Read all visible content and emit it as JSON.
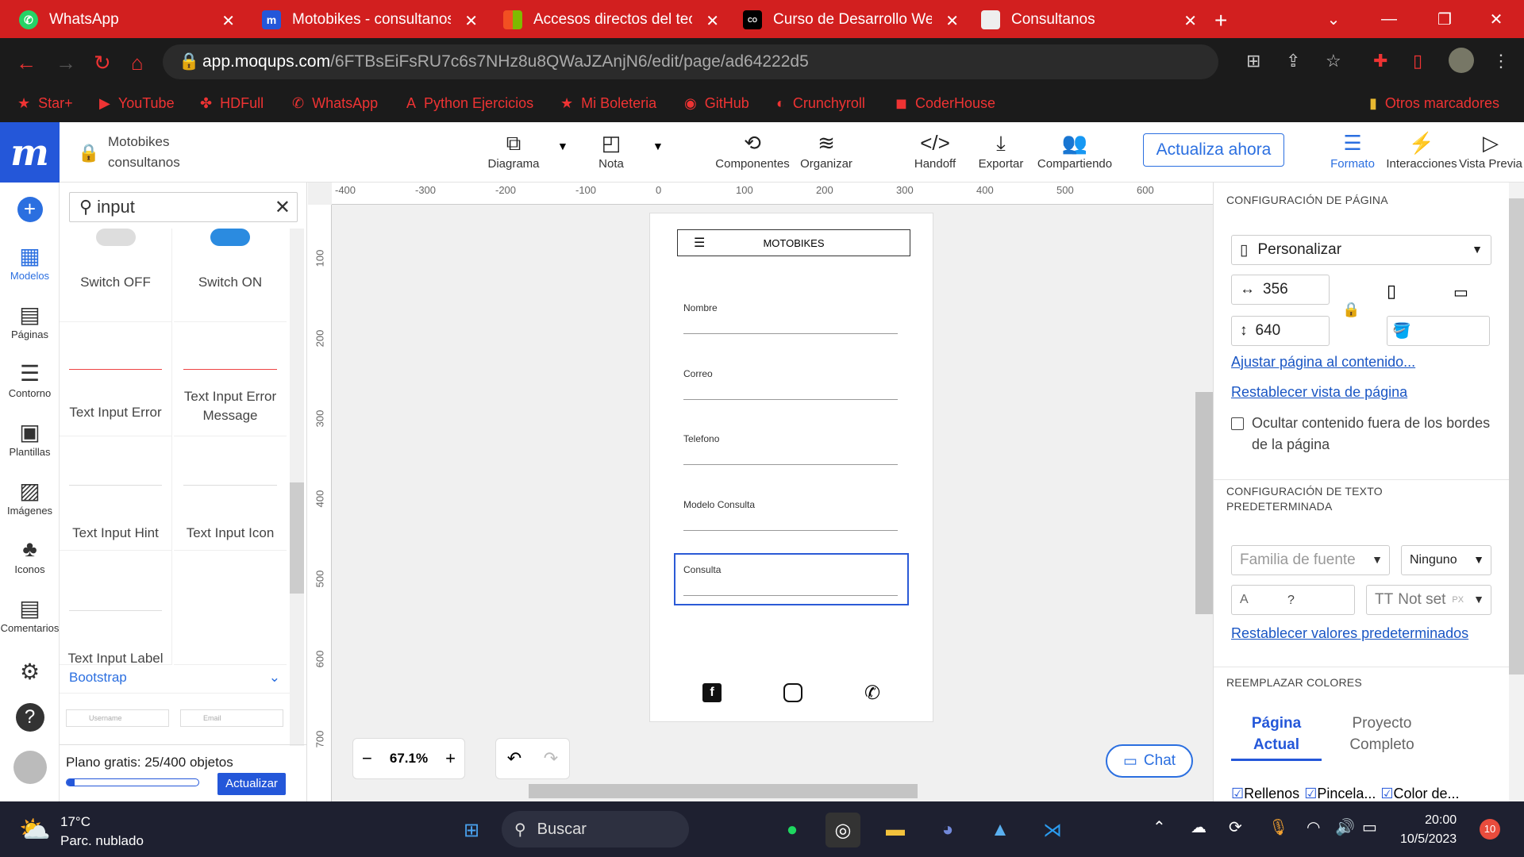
{
  "browser": {
    "tabs": [
      {
        "title": "WhatsApp",
        "icon": "whatsapp-icon"
      },
      {
        "title": "Motobikes - consultanos",
        "icon": "moqups-icon"
      },
      {
        "title": "Accesos directos del tecl",
        "icon": "microsoft-icon"
      },
      {
        "title": "Curso de Desarrollo Web",
        "icon": "coder-icon"
      },
      {
        "title": "Consultanos",
        "icon": "page-icon"
      }
    ],
    "url_host": "app.moqups.com",
    "url_path": "/6FTBsEiFsRU7c6s7NHz8u8QWaJZAnjN6/edit/page/ad64222d5",
    "bookmarks": [
      "Star+",
      "YouTube",
      "HDFull",
      "WhatsApp",
      "Python Ejercicios",
      "Mi Boleteria",
      "GitHub",
      "Crunchyroll",
      "CoderHouse"
    ],
    "other_bookmarks": "Otros marcadores"
  },
  "app": {
    "logo": "m",
    "project_name": "Motobikes",
    "project_sub": "consultanos",
    "tools": [
      "Diagrama",
      "Nota",
      "Componentes",
      "Organizar",
      "Handoff",
      "Exportar",
      "Compartiendo"
    ],
    "update_button": "Actualiza ahora",
    "right_tools": [
      "Formato",
      "Interacciones",
      "Vista Previa"
    ],
    "rail": [
      "Modelos",
      "Páginas",
      "Contorno",
      "Plantillas",
      "Imágenes",
      "Iconos",
      "Comentarios"
    ]
  },
  "panel": {
    "search_value": "input",
    "cells": [
      "Switch OFF",
      "Switch ON",
      "Text Input Error",
      "Text Input Error Message",
      "Text Input Hint",
      "Text Input Icon",
      "Text Input Label"
    ],
    "section": "Bootstrap",
    "bootstrap_placeholders": [
      "Username",
      "Email"
    ],
    "plan_text": "Plano gratis: 25/400 objetos",
    "plan_progress": 0.0625,
    "upgrade": "Actualizar"
  },
  "canvas": {
    "ruler_h": [
      "-400",
      "-300",
      "-200",
      "-100",
      "0",
      "100",
      "200",
      "300",
      "400",
      "500",
      "600"
    ],
    "ruler_v": [
      "100",
      "200",
      "300",
      "400",
      "500",
      "600",
      "700"
    ],
    "header": "MOTOBIKES",
    "fields": [
      "Nombre",
      "Correo",
      "Telefono",
      "Modelo Consulta",
      "Consulta"
    ],
    "zoom": "67.1%",
    "chat": "Chat"
  },
  "format": {
    "page_config": "CONFIGURACIÓN DE PÁGINA",
    "preset": "Personalizar",
    "width": "356",
    "height": "640",
    "fit_link": "Ajustar página al contenido...",
    "reset_link": "Restablecer vista de página",
    "hide_label": "Ocultar contenido fuera de los bordes de la página",
    "text_config": "CONFIGURACIÓN DE TEXTO PREDETERMINADA",
    "font_placeholder": "Familia de fuente",
    "font_style": "Ninguno",
    "font_size_q": "?",
    "not_set": "Not set",
    "px": "PX",
    "reset_defaults": "Restablecer valores predeterminados",
    "replace_colors": "REEMPLAZAR COLORES",
    "tab_page": "Página Actual",
    "tab_project": "Proyecto Completo",
    "checks": [
      "Rellenos",
      "Pincela...",
      "Color de..."
    ]
  },
  "taskbar": {
    "temp": "17°C",
    "weather": "Parc. nublado",
    "search": "Buscar",
    "time": "20:00",
    "date": "10/5/2023",
    "badge": "10"
  }
}
